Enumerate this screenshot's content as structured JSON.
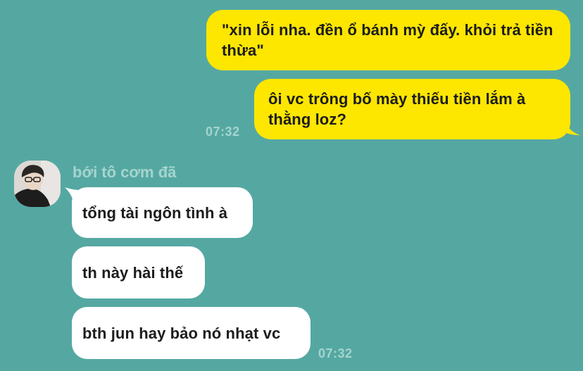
{
  "conversation": {
    "messages": [
      {
        "direction": "outgoing",
        "text": "\"xin lỗi nha. đền ổ bánh mỳ đấy. khỏi trả tiền thừa\""
      },
      {
        "direction": "outgoing",
        "text": "ôi vc trông bố mày thiếu tiền lắm à thằng loz?"
      },
      {
        "direction": "incoming",
        "text": "tổng tài ngôn tình à"
      },
      {
        "direction": "incoming",
        "text": "th này hài thế"
      },
      {
        "direction": "incoming",
        "text": "bth jun hay bảo nó nhạt vc"
      }
    ],
    "outgoing_timestamp": "07:32",
    "incoming_timestamp": "07:32",
    "sender_name": "bới tô cơm đã"
  },
  "colors": {
    "background": "#55a8a2",
    "outgoing_bubble": "#fde600",
    "incoming_bubble": "#ffffff",
    "meta_text": "#a6d4cf"
  }
}
